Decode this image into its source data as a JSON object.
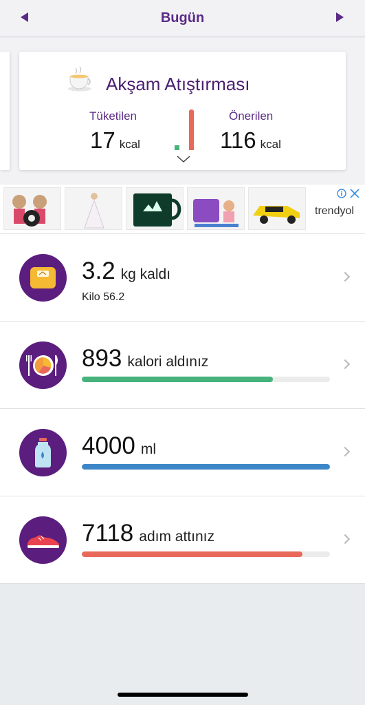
{
  "header": {
    "title": "Bugün",
    "prev_label": "",
    "next_label": ""
  },
  "meal_card": {
    "title": "Akşam Atıştırması",
    "icon": "teacup-icon",
    "consumed_label": "Tüketilen",
    "consumed_value": "17",
    "consumed_unit": "kcal",
    "recommended_label": "Önerilen",
    "recommended_value": "116",
    "recommended_unit": "kcal",
    "consumed_fraction": 0.15
  },
  "ad": {
    "brand": "trendyol",
    "items": [
      "toy-dolls-image",
      "doll-image",
      "mug-image",
      "toy-set-image",
      "toy-car-image"
    ]
  },
  "rows": [
    {
      "icon": "scale-icon",
      "value": "3.2",
      "text": "kg kaldı",
      "subtitle": "Kilo 56.2"
    },
    {
      "icon": "plate-cutlery-icon",
      "value": "893",
      "text": "kalori aldınız",
      "progress": 0.77,
      "color": "#46b37c"
    },
    {
      "icon": "water-bottle-icon",
      "value": "4000",
      "text": "ml",
      "progress": 1.0,
      "color": "#3d87c9"
    },
    {
      "icon": "sneaker-icon",
      "value": "7118",
      "text": "adım attınız",
      "progress": 0.89,
      "color": "#e8685a"
    }
  ],
  "colors": {
    "brand_purple": "#5b1e7e",
    "accent_purple": "#5b2a86",
    "green": "#46b37c",
    "blue": "#3d87c9",
    "red": "#e8685a"
  }
}
